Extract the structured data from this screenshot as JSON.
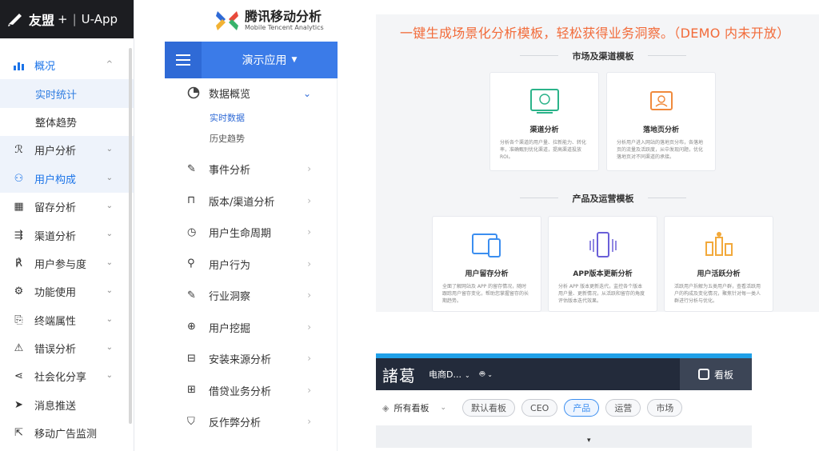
{
  "umeng": {
    "brand": "友盟",
    "plus": "+",
    "separator": "|",
    "product": "U-App",
    "menu": [
      {
        "label": "概况",
        "expanded": true
      },
      {
        "label": "实时统计",
        "sub": true,
        "active": true
      },
      {
        "label": "整体趋势",
        "sub": true
      },
      {
        "label": "用户分析"
      },
      {
        "label": "用户构成"
      },
      {
        "label": "留存分析"
      },
      {
        "label": "渠道分析"
      },
      {
        "label": "用户参与度"
      },
      {
        "label": "功能使用"
      },
      {
        "label": "终端属性"
      },
      {
        "label": "错误分析"
      },
      {
        "label": "社会化分享"
      },
      {
        "label": "消息推送"
      },
      {
        "label": "移动广告监测"
      }
    ]
  },
  "tencent": {
    "logo_title": "腾讯移动分析",
    "logo_sub": "Mobile Tencent Analytics",
    "app_selector": "演示应用",
    "top_menu": "数据概览",
    "sub_items": [
      "实时数据",
      "历史趋势"
    ],
    "menu": [
      "事件分析",
      "版本/渠道分析",
      "用户生命周期",
      "用户行为",
      "行业洞察",
      "用户挖掘",
      "安装来源分析",
      "借贷业务分析",
      "反作弊分析"
    ]
  },
  "templates": {
    "headline": "一键生成场景化分析模板，轻松获得业务洞察。（DEMO 内未开放）",
    "section1": "市场及渠道模板",
    "section2": "产品及运营模板",
    "cards": [
      {
        "title": "渠道分析",
        "desc": "分析各个渠道的用户量、拉新能力、转化率，准确甄别优化渠道，提高渠道投放ROI。"
      },
      {
        "title": "落地页分析",
        "desc": "分析用户进入网站的落地页分布，各落地页的流量及活跃度，从中发现问题，优化落地页对不同渠道的承接。"
      },
      {
        "title": "用户留存分析",
        "desc": "全面了解网站及 APP 的留存情况，随时跟踪用户留存变化，帮助您掌握留存的长期趋势。"
      },
      {
        "title": "APP版本更新分析",
        "desc": "分析 APP 版本更新迭代，监控各个版本用户量、更新情况，从活跃和留存的角度评估版本迭代效果。"
      },
      {
        "title": "用户活跃分析",
        "desc": "活跃用户拆解为五类用户群，查看活跃用户的构成及变化情况，聚焦针对每一类人群进行分析与优化。"
      }
    ]
  },
  "zhuge": {
    "logo": "諸葛",
    "project": "电商D...",
    "board_button": "看板",
    "all_boards": "所有看板",
    "chips": [
      "默认看板",
      "CEO",
      "产品",
      "运营",
      "市场"
    ],
    "active_chip": "产品",
    "colors": {
      "header": "#232b3b",
      "accent": "#3b8ef0"
    }
  }
}
